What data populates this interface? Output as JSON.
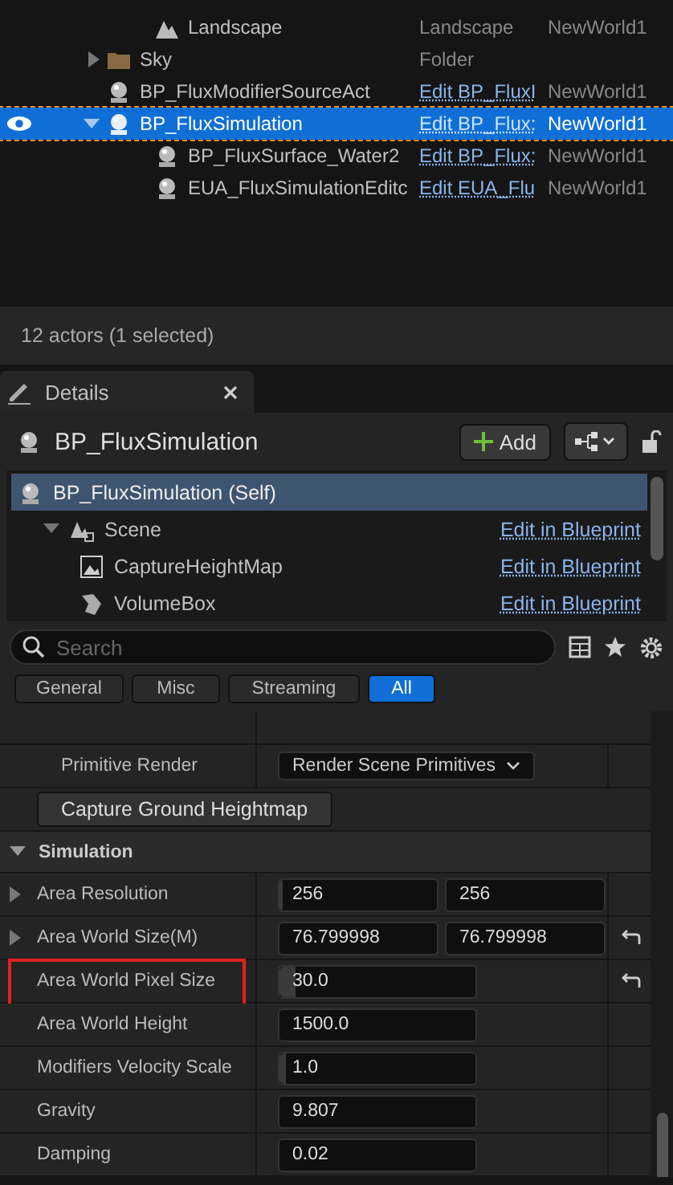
{
  "outliner": {
    "rows": [
      {
        "name": "Landscape",
        "type": "Landscape",
        "world": "NewWorld1",
        "kind": "landscape",
        "visible_eye": false,
        "selected": false
      },
      {
        "name": "Sky",
        "type": "Folder",
        "kind": "folder",
        "expanded": false,
        "visible_eye": false,
        "selected": false
      },
      {
        "name": "BP_FluxModifierSourceAct",
        "type": "Edit BP_FluxI",
        "world": "NewWorld1",
        "kind": "blueprint",
        "visible_eye": false,
        "selected": false
      },
      {
        "name": "BP_FluxSimulation",
        "type": "Edit BP_Flux:",
        "world": "NewWorld1",
        "kind": "blueprint",
        "expanded": true,
        "visible_eye": true,
        "selected": true,
        "children": [
          {
            "name": "BP_FluxSurface_Water2",
            "type": "Edit BP_Flux:",
            "world": "NewWorld1",
            "kind": "blueprint",
            "visible_eye": false,
            "selected": false
          },
          {
            "name": "EUA_FluxSimulationEditc",
            "type": "Edit EUA_Flu",
            "world": "NewWorld1",
            "kind": "blueprint",
            "visible_eye": false,
            "selected": false
          }
        ]
      }
    ],
    "status": "12 actors (1 selected)"
  },
  "details": {
    "tab": "Details",
    "actor": "BP_FluxSimulation",
    "add_button": "Add",
    "components": [
      {
        "name": "BP_FluxSimulation (Self)",
        "kind": "actor",
        "selected": true,
        "children": [
          {
            "name": "Scene",
            "link": "Edit in Blueprint",
            "kind": "scene",
            "expanded": true,
            "selected": false,
            "children": [
              {
                "name": "CaptureHeightMap",
                "link": "Edit in Blueprint",
                "kind": "image",
                "selected": false
              },
              {
                "name": "VolumeBox",
                "link": "Edit in Blueprint",
                "kind": "volume",
                "selected": false
              }
            ]
          }
        ]
      }
    ],
    "search": {
      "placeholder": "Search"
    },
    "filters": [
      {
        "label": "General",
        "selected": false
      },
      {
        "label": "Misc",
        "selected": false
      },
      {
        "label": "Streaming",
        "selected": false
      },
      {
        "label": "All",
        "selected": true
      }
    ],
    "primitive_render": {
      "label": "Primitive Render",
      "value": "Render Scene Primitives"
    },
    "capture_button": "Capture Ground Heightmap",
    "section": "Simulation",
    "properties": [
      {
        "label": "Area Resolution",
        "expandable": true,
        "values": [
          "256",
          "256"
        ],
        "level": 0.01,
        "resettable": false,
        "highlighted": false
      },
      {
        "label": "Area World Size(M)",
        "expandable": true,
        "values": [
          "76.799998",
          "76.799998"
        ],
        "resettable": true,
        "highlighted": false
      },
      {
        "label": "Area World Pixel Size",
        "expandable": false,
        "values": [
          "30.0"
        ],
        "level": 0.08,
        "resettable": true,
        "highlighted": true
      },
      {
        "label": "Area World Height",
        "expandable": false,
        "values": [
          "1500.0"
        ],
        "resettable": false,
        "highlighted": false
      },
      {
        "label": "Modifiers Velocity Scale",
        "expandable": false,
        "values": [
          "1.0"
        ],
        "level": 0.03,
        "resettable": false,
        "highlighted": false
      },
      {
        "label": "Gravity",
        "expandable": false,
        "values": [
          "9.807"
        ],
        "resettable": false,
        "highlighted": false
      },
      {
        "label": "Damping",
        "expandable": false,
        "values": [
          "0.02"
        ],
        "resettable": false,
        "highlighted": false
      }
    ]
  }
}
